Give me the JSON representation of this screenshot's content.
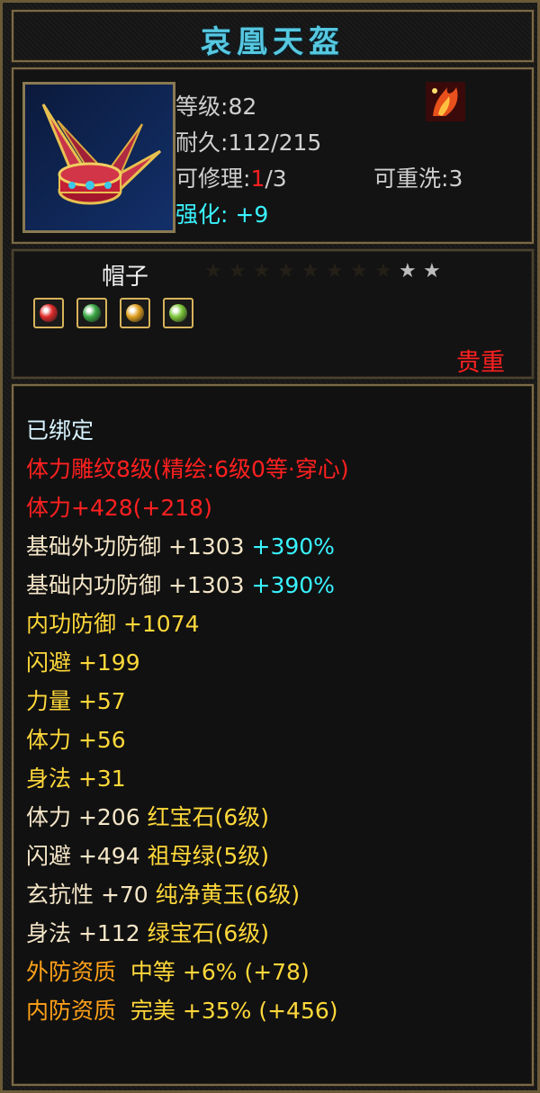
{
  "title": "哀凰天盔",
  "info": {
    "level_label": "等级",
    "level_value": "82",
    "durability_label": "耐久",
    "durability_value": "112/215",
    "repair_label": "可修理",
    "repair_current": "1",
    "repair_total": "/3",
    "reroll_label": "可重洗",
    "reroll_value": "3",
    "enhance_label": "强化:",
    "enhance_value": "+9"
  },
  "item_type": "帽子",
  "stars_total": 10,
  "stars_lit": 2,
  "gems": [
    {
      "icon": "red-gem-icon",
      "color": "#e02a2a"
    },
    {
      "icon": "green-gem-icon",
      "color": "#39a845"
    },
    {
      "icon": "yellow-gem-icon",
      "color": "#e0a020"
    },
    {
      "icon": "light-green-gem-icon",
      "color": "#7cc63a"
    }
  ],
  "rarity": "贵重",
  "stats": {
    "bound": "已绑定",
    "engrave": "体力雕纹8级(精绘:6级0等·穿心)",
    "stamina_main": "体力+428(+218)",
    "ext_def_label": "基础外功防御",
    "ext_def_value": "+1303",
    "ext_def_pct": "+390%",
    "int_def_label": "基础内功防御",
    "int_def_value": "+1303",
    "int_def_pct": "+390%",
    "s1": "内功防御 +1074",
    "s2": "闪避 +199",
    "s3": "力量 +57",
    "s4": "体力 +56",
    "s5": "身法 +31",
    "g1_stat": "体力 +206",
    "g1_gem": "红宝石(6级)",
    "g2_stat": "闪避 +494",
    "g2_gem": "祖母绿(5级)",
    "g3_stat": "玄抗性 +70",
    "g3_gem": "纯净黄玉(6级)",
    "g4_stat": "身法 +112",
    "g4_gem": "绿宝石(6级)",
    "q1_label": "外防资质",
    "q1_grade": "中等",
    "q1_value": "+6% (+78)",
    "q2_label": "内防资质",
    "q2_grade": "完美",
    "q2_value": "+35% (+456)"
  }
}
